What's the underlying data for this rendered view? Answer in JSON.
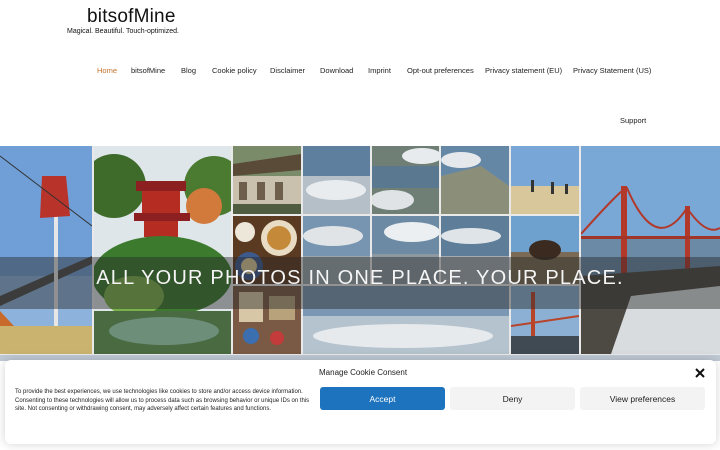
{
  "site": {
    "title": "bitsofMine",
    "tagline": "Magical. Beautiful. Touch-optimized."
  },
  "nav": {
    "items": [
      {
        "label": "Home",
        "active": true
      },
      {
        "label": "bitsofMine"
      },
      {
        "label": "Blog"
      },
      {
        "label": "Cookie policy"
      },
      {
        "label": "Disclaimer"
      },
      {
        "label": "Download"
      },
      {
        "label": "Imprint"
      },
      {
        "label": "Opt-out preferences"
      },
      {
        "label": "Privacy statement (EU)"
      },
      {
        "label": "Privacy Statement (US)"
      },
      {
        "label": "Support"
      }
    ]
  },
  "hero": {
    "headline": "ALL YOUR PHOTOS IN ONE PLACE. YOUR PLACE."
  },
  "cookie": {
    "title": "Manage Cookie Consent",
    "text": "To provide the best experiences, we use technologies like cookies to store and/or access device information. Consenting to these technologies will allow us to process data such as browsing behavior or unique IDs on this site. Not consenting or withdrawing consent, may adversely affect certain features and functions.",
    "accept_label": "Accept",
    "deny_label": "Deny",
    "preferences_label": "View preferences"
  },
  "colors": {
    "accent": "#1e73be",
    "nav_active": "#c4702a"
  },
  "icons": {
    "close": "close-icon"
  }
}
